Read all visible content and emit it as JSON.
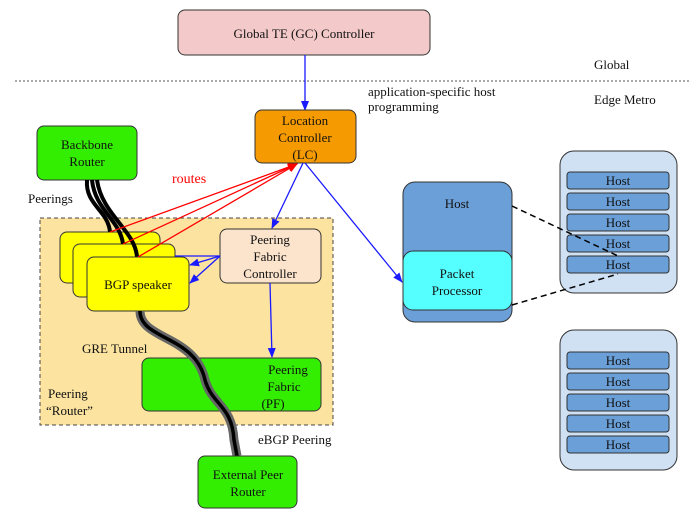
{
  "labels": {
    "global_controller": "Global TE (GC) Controller",
    "global": "Global",
    "edge_metro": "Edge Metro",
    "app_host_line1": "application-specific host",
    "app_host_line2": "programming",
    "lc_line1": "Location",
    "lc_line2": "Controller",
    "lc_line3": "(LC)",
    "backbone_line1": "Backbone",
    "backbone_line2": "Router",
    "peerings": "Peerings",
    "routes": "routes",
    "bgp_speaker": "BGP speaker",
    "pfc_line1": "Peering",
    "pfc_line2": "Fabric",
    "pfc_line3": "Controller",
    "gre_tunnel": "GRE Tunnel",
    "pf_line1": "Peering",
    "pf_line2": "Fabric",
    "pf_line3": "(PF)",
    "peering_router_line1": "Peering",
    "peering_router_line2": "“Router”",
    "ebgp_peering": "eBGP Peering",
    "ext_line1": "External Peer",
    "ext_line2": "Router",
    "host": "Host",
    "pp_line1": "Packet",
    "pp_line2": "Processor"
  },
  "racks": [
    {
      "hosts": [
        "Host",
        "Host",
        "Host",
        "Host",
        "Host"
      ]
    },
    {
      "hosts": [
        "Host",
        "Host",
        "Host",
        "Host",
        "Host"
      ]
    }
  ],
  "colors": {
    "global_controller": "#f4c9c9",
    "location_controller": "#f59a00",
    "router_green": "#33ee00",
    "bgp_yellow": "#ffff00",
    "pfc": "#fbe3cc",
    "peering_region": "#fce3a0",
    "host": "#6a9fd8",
    "packet_processor": "#55ffff",
    "rack": "#d0e1f4",
    "routes_red": "#ff0000",
    "control_blue": "#1a1aff"
  }
}
